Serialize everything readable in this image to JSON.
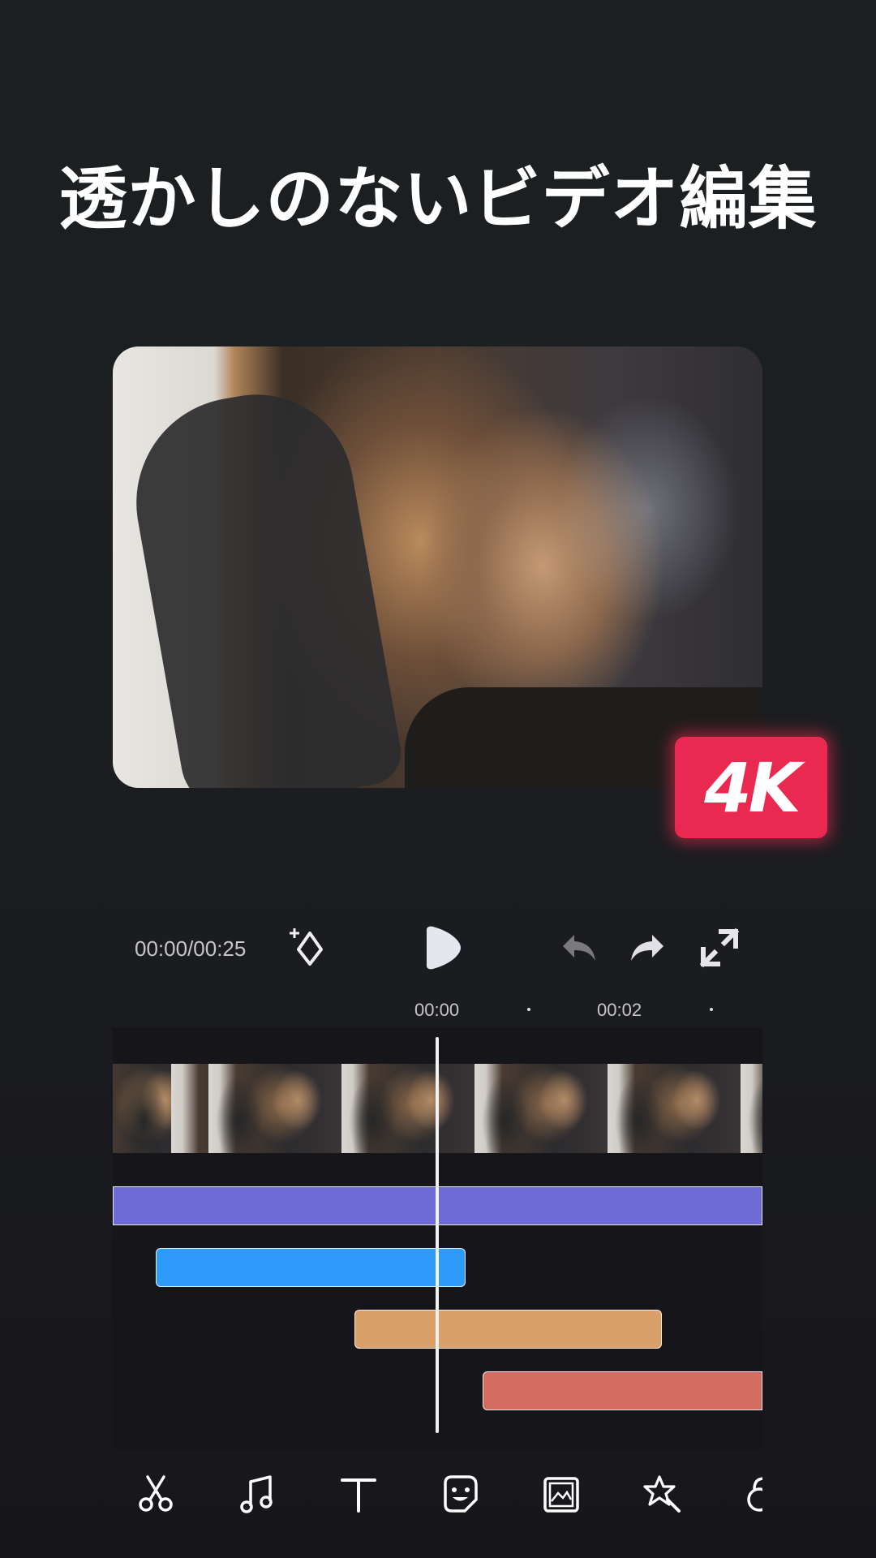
{
  "headline": "透かしのないビデオ編集",
  "badge": {
    "label": "4K",
    "color": "#e9294f"
  },
  "player": {
    "time_readout": "00:00/00:25",
    "controls": [
      "keyframe-add-icon",
      "play-icon",
      "undo-icon",
      "redo-icon",
      "fullscreen-icon"
    ]
  },
  "ruler": {
    "labels": [
      "00:00",
      "00:02"
    ]
  },
  "tracks": {
    "colors": {
      "overlay": "#6f6bd6",
      "music": "#2e9bfa",
      "text": "#dba06a",
      "effect": "#d46b60"
    }
  },
  "toolbar": {
    "tools": [
      "cut-icon",
      "music-icon",
      "text-icon",
      "sticker-icon",
      "image-icon",
      "effects-icon",
      "filter-icon"
    ]
  }
}
